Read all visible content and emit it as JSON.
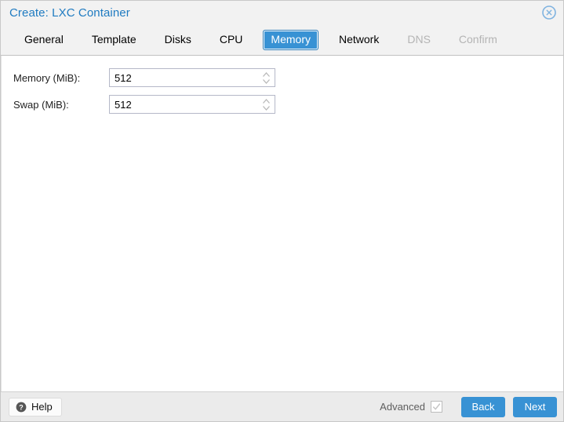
{
  "header": {
    "title": "Create: LXC Container",
    "close_icon": "close-circle-icon"
  },
  "tabs": [
    {
      "label": "General",
      "state": "normal"
    },
    {
      "label": "Template",
      "state": "normal"
    },
    {
      "label": "Disks",
      "state": "normal"
    },
    {
      "label": "CPU",
      "state": "normal"
    },
    {
      "label": "Memory",
      "state": "active"
    },
    {
      "label": "Network",
      "state": "normal"
    },
    {
      "label": "DNS",
      "state": "disabled"
    },
    {
      "label": "Confirm",
      "state": "disabled"
    }
  ],
  "form": {
    "fields": [
      {
        "label": "Memory (MiB):",
        "value": "512",
        "placeholder": "",
        "spinner_icon": "spinner-updown-icon"
      },
      {
        "label": "Swap (MiB):",
        "value": "512",
        "placeholder": "",
        "spinner_icon": "spinner-updown-icon"
      }
    ]
  },
  "footer": {
    "help_label": "Help",
    "help_icon": "question-circle-icon",
    "advanced_label": "Advanced",
    "advanced_checked": false,
    "back_label": "Back",
    "next_label": "Next"
  },
  "colors": {
    "accent_blue": "#3892d4",
    "title_blue": "#1f7bc1",
    "disabled_gray": "#b4b4b4",
    "header_bg": "#f2f2f2",
    "footer_bg": "#ebebeb"
  }
}
